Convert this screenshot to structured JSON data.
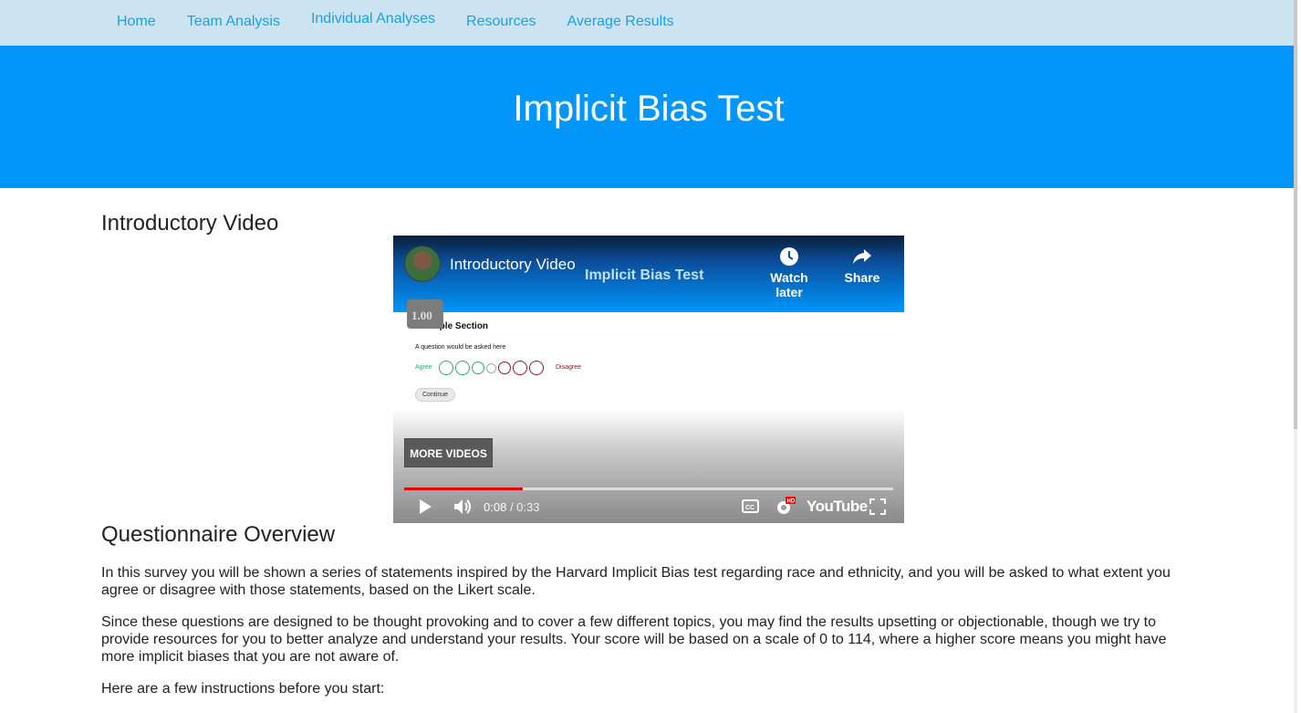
{
  "nav": {
    "items": [
      {
        "label": "Home"
      },
      {
        "label": "Team Analysis"
      },
      {
        "label": "Individual Analyses"
      },
      {
        "label": "Resources"
      },
      {
        "label": "Average Results"
      }
    ]
  },
  "hero": {
    "title": "Implicit Bias Test"
  },
  "intro": {
    "heading": "Introductory Video"
  },
  "video": {
    "title": "Introductory Video",
    "overlay_title": "Implicit Bias Test",
    "watch_later_label": "Watch later",
    "share_label": "Share",
    "speed_badge": "1.00",
    "slide": {
      "section": "Example Section",
      "question": "A question would be asked here",
      "agree_label": "Agree",
      "disagree_label": "Disagree",
      "continue_label": "Continue"
    },
    "more_videos_label": "MORE VIDEOS",
    "current_time": "0:08",
    "duration": "/ 0:33",
    "progress_fraction": 0.242,
    "youtube_label": "YouTube",
    "accent_color": "#e00000"
  },
  "overview": {
    "heading": "Questionnaire Overview",
    "paragraphs": [
      "In this survey you will be shown a series of statements inspired by the Harvard Implicit Bias test regarding race and ethnicity, and you will be asked to what extent you agree or disagree with those statements, based on the Likert scale.",
      "Since these questions are designed to be thought provoking and to cover a few different topics, you may find the results upsetting or objectionable, though we try to provide resources for you to better analyze and understand your results. Your score will be based on a scale of 0 to 114, where a higher score means you might have more implicit biases that you are not aware of.",
      "Here are a few instructions before you start:"
    ]
  },
  "colors": {
    "nav_bg": "#cce3f2",
    "nav_link": "#1ba1e2",
    "hero_bg": "#0096fb"
  }
}
